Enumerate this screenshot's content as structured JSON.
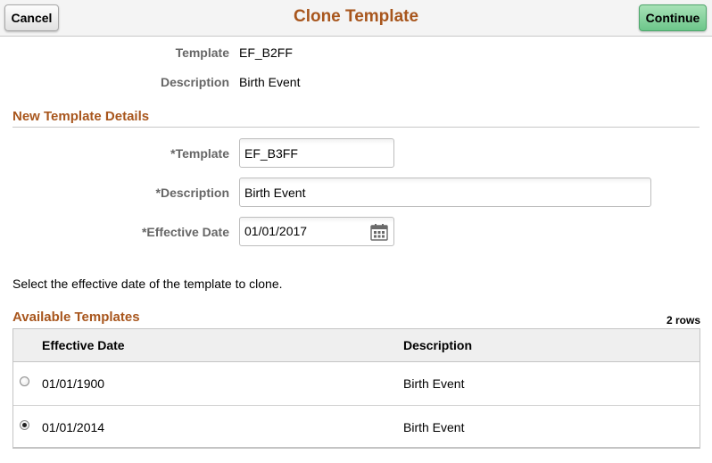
{
  "header": {
    "title": "Clone Template",
    "cancel_label": "Cancel",
    "continue_label": "Continue"
  },
  "source": {
    "template_label": "Template",
    "template_value": "EF_B2FF",
    "description_label": "Description",
    "description_value": "Birth Event"
  },
  "new_template": {
    "section_title": "New Template Details",
    "template_label": "*Template",
    "template_value": "EF_B3FF",
    "description_label": "*Description",
    "description_value": "Birth Event",
    "effective_date_label": "*Effective Date",
    "effective_date_value": "01/01/2017",
    "calendar_icon": "calendar-icon"
  },
  "instruction": "Select the effective date of the template to clone.",
  "available": {
    "section_title": "Available Templates",
    "row_count": "2 rows",
    "columns": [
      "Effective Date",
      "Description"
    ],
    "rows": [
      {
        "effective_date": "01/01/1900",
        "description": "Birth Event",
        "selected": false
      },
      {
        "effective_date": "01/01/2014",
        "description": "Birth Event",
        "selected": true
      }
    ]
  },
  "colors": {
    "title": "#a8561d",
    "continue_button": "#6cc68a",
    "label_gray": "#666666"
  }
}
